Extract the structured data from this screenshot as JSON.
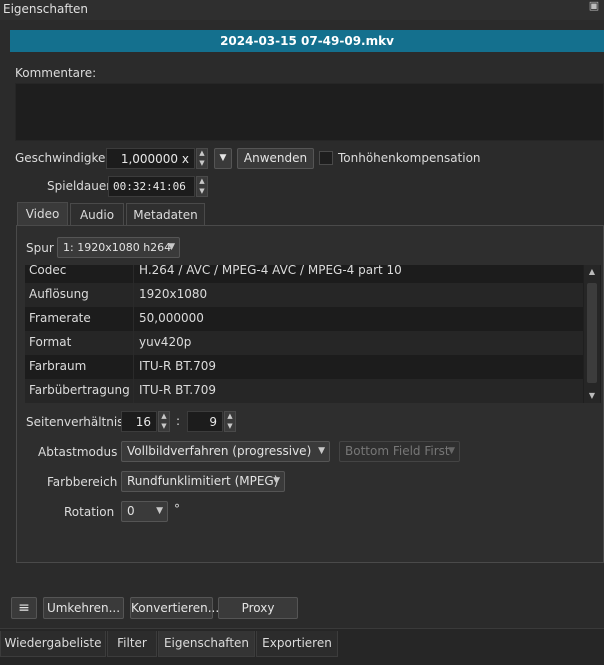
{
  "window": {
    "title": "Eigenschaften"
  },
  "file": {
    "name": "2024-03-15 07-49-09.mkv"
  },
  "comments": {
    "label": "Kommentare:"
  },
  "speed": {
    "label": "Geschwindigkeit",
    "value": "1,000000 x",
    "apply_label": "Anwenden",
    "pitch_label": "Tonhöhenkompensation",
    "pitch_checked": false
  },
  "duration": {
    "label": "Spieldauer",
    "value": "00:32:41:06"
  },
  "tabs": [
    {
      "label": "Video",
      "active": true
    },
    {
      "label": "Audio",
      "active": false
    },
    {
      "label": "Metadaten",
      "active": false
    }
  ],
  "track": {
    "label": "Spur",
    "value": "1: 1920x1080 h264"
  },
  "properties": [
    {
      "key": "Codec",
      "value": "H.264 / AVC / MPEG-4 AVC / MPEG-4 part 10"
    },
    {
      "key": "Auflösung",
      "value": "1920x1080"
    },
    {
      "key": "Framerate",
      "value": "50,000000"
    },
    {
      "key": "Format",
      "value": "yuv420p"
    },
    {
      "key": "Farbraum",
      "value": "ITU-R BT.709"
    },
    {
      "key": "Farbübertragung",
      "value": "ITU-R BT.709"
    }
  ],
  "aspect": {
    "label": "Seitenverhältnis",
    "w": "16",
    "sep": ":",
    "h": "9"
  },
  "scan": {
    "label": "Abtastmodus",
    "value": "Vollbildverfahren (progressive)",
    "field_order": "Bottom Field First"
  },
  "color_range": {
    "label": "Farbbereich",
    "value": "Rundfunklimitiert (MPEG)"
  },
  "rotation": {
    "label": "Rotation",
    "value": "0",
    "unit": "°"
  },
  "actions": {
    "menu_icon": "≡",
    "reverse": "Umkehren...",
    "convert": "Konvertieren...",
    "proxy": "Proxy"
  },
  "bottom_tabs": [
    {
      "label": "Wiedergabeliste",
      "active": false
    },
    {
      "label": "Filter",
      "active": false
    },
    {
      "label": "Eigenschaften",
      "active": true
    },
    {
      "label": "Exportieren",
      "active": false
    }
  ],
  "colors": {
    "accent": "#14708e",
    "background": "#2b2b2b"
  }
}
